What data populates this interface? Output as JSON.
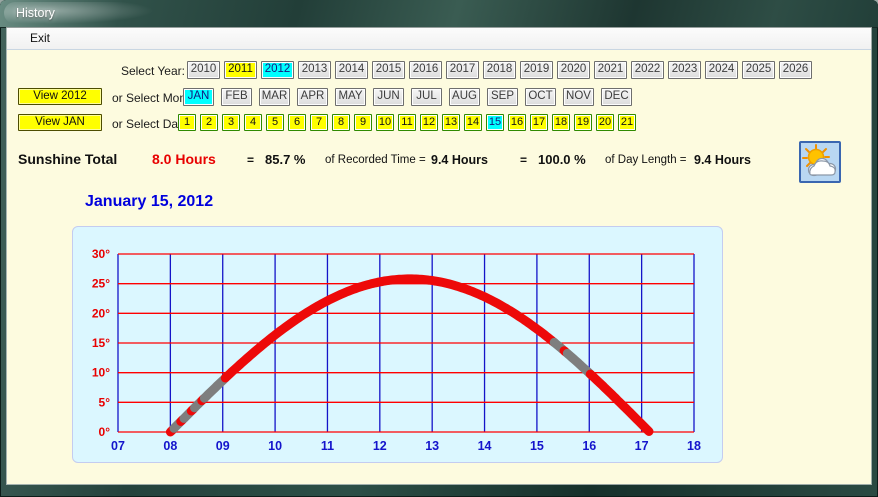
{
  "window": {
    "title": "History"
  },
  "menu": {
    "items": [
      {
        "label": "Exit"
      }
    ]
  },
  "year_selector": {
    "label": "Select Year:",
    "years": [
      {
        "label": "2010",
        "state": "default"
      },
      {
        "label": "2011",
        "state": "highlighted"
      },
      {
        "label": "2012",
        "state": "selected"
      },
      {
        "label": "2013",
        "state": "default"
      },
      {
        "label": "2014",
        "state": "default"
      },
      {
        "label": "2015",
        "state": "default"
      },
      {
        "label": "2016",
        "state": "default"
      },
      {
        "label": "2017",
        "state": "default"
      },
      {
        "label": "2018",
        "state": "default"
      },
      {
        "label": "2019",
        "state": "default"
      },
      {
        "label": "2020",
        "state": "default"
      },
      {
        "label": "2021",
        "state": "default"
      },
      {
        "label": "2022",
        "state": "default"
      },
      {
        "label": "2023",
        "state": "default"
      },
      {
        "label": "2024",
        "state": "default"
      },
      {
        "label": "2025",
        "state": "default"
      },
      {
        "label": "2026",
        "state": "default"
      }
    ]
  },
  "month_selector": {
    "view_button": "View 2012",
    "label": "or Select Month:",
    "months": [
      {
        "label": "JAN",
        "state": "selected"
      },
      {
        "label": "FEB",
        "state": "default"
      },
      {
        "label": "MAR",
        "state": "default"
      },
      {
        "label": "APR",
        "state": "default"
      },
      {
        "label": "MAY",
        "state": "default"
      },
      {
        "label": "JUN",
        "state": "default"
      },
      {
        "label": "JUL",
        "state": "default"
      },
      {
        "label": "AUG",
        "state": "default"
      },
      {
        "label": "SEP",
        "state": "default"
      },
      {
        "label": "OCT",
        "state": "default"
      },
      {
        "label": "NOV",
        "state": "default"
      },
      {
        "label": "DEC",
        "state": "default"
      }
    ]
  },
  "date_selector": {
    "view_button": "View JAN",
    "label": "or Select Date:",
    "dates": [
      {
        "label": "1",
        "state": "highlighted"
      },
      {
        "label": "2",
        "state": "highlighted"
      },
      {
        "label": "3",
        "state": "highlighted"
      },
      {
        "label": "4",
        "state": "highlighted"
      },
      {
        "label": "5",
        "state": "highlighted"
      },
      {
        "label": "6",
        "state": "highlighted"
      },
      {
        "label": "7",
        "state": "highlighted"
      },
      {
        "label": "8",
        "state": "highlighted"
      },
      {
        "label": "9",
        "state": "highlighted"
      },
      {
        "label": "10",
        "state": "highlighted"
      },
      {
        "label": "11",
        "state": "highlighted"
      },
      {
        "label": "12",
        "state": "highlighted"
      },
      {
        "label": "13",
        "state": "highlighted"
      },
      {
        "label": "14",
        "state": "highlighted"
      },
      {
        "label": "15",
        "state": "selected"
      },
      {
        "label": "16",
        "state": "highlighted"
      },
      {
        "label": "17",
        "state": "highlighted"
      },
      {
        "label": "18",
        "state": "highlighted"
      },
      {
        "label": "19",
        "state": "highlighted"
      },
      {
        "label": "20",
        "state": "highlighted"
      },
      {
        "label": "21",
        "state": "highlighted"
      }
    ]
  },
  "summary": {
    "title": "Sunshine Total",
    "total_value": "8.0 Hours",
    "total_color": "#e80000",
    "eq1": "=",
    "recorded_pct": "85.7 %",
    "recorded_label": "of Recorded Time =",
    "recorded_value": "9.4 Hours",
    "eq2": "=",
    "daylength_pct": "100.0 %",
    "daylength_label": "of Day Length =",
    "daylength_value": "9.4 Hours",
    "weather_icon": "sun-behind-cloud-icon"
  },
  "chart_data": {
    "type": "line",
    "title": "January 15, 2012",
    "x_ticks": [
      "07",
      "08",
      "09",
      "10",
      "11",
      "12",
      "13",
      "14",
      "15",
      "16",
      "17",
      "18"
    ],
    "x_range": [
      7,
      18
    ],
    "y_ticks": [
      "0°",
      "5°",
      "10°",
      "15°",
      "20°",
      "25°",
      "30°"
    ],
    "y_tick_values": [
      0,
      5,
      10,
      15,
      20,
      25,
      30
    ],
    "y_range": [
      0,
      30
    ],
    "grid": {
      "vertical_color": "#1414c8",
      "horizontal_color": "#ff0000"
    },
    "plot_bg": "#dbf7ff",
    "axis_label_colors": {
      "x": "#1414cc",
      "y": "#e80000"
    },
    "series": [
      {
        "name": "sun-elevation-path",
        "color_sunny": "#ed0909",
        "color_cloudy": "#7e7e7e",
        "curve_start_hour": 8.0,
        "curve_end_hour": 17.15,
        "peak_hour": 12.6,
        "peak_elevation_deg": 25.8,
        "segments": [
          {
            "from": 8.0,
            "to": 8.07,
            "sky": "sun"
          },
          {
            "from": 8.07,
            "to": 8.2,
            "sky": "cloud"
          },
          {
            "from": 8.2,
            "to": 8.26,
            "sky": "sun"
          },
          {
            "from": 8.26,
            "to": 8.4,
            "sky": "cloud"
          },
          {
            "from": 8.4,
            "to": 8.46,
            "sky": "sun"
          },
          {
            "from": 8.46,
            "to": 8.6,
            "sky": "cloud"
          },
          {
            "from": 8.6,
            "to": 8.65,
            "sky": "sun"
          },
          {
            "from": 8.65,
            "to": 9.05,
            "sky": "cloud"
          },
          {
            "from": 9.05,
            "to": 15.33,
            "sky": "sun"
          },
          {
            "from": 15.33,
            "to": 15.52,
            "sky": "cloud"
          },
          {
            "from": 15.52,
            "to": 15.58,
            "sky": "sun"
          },
          {
            "from": 15.58,
            "to": 16.02,
            "sky": "cloud"
          },
          {
            "from": 16.02,
            "to": 17.15,
            "sky": "sun"
          }
        ]
      }
    ]
  }
}
